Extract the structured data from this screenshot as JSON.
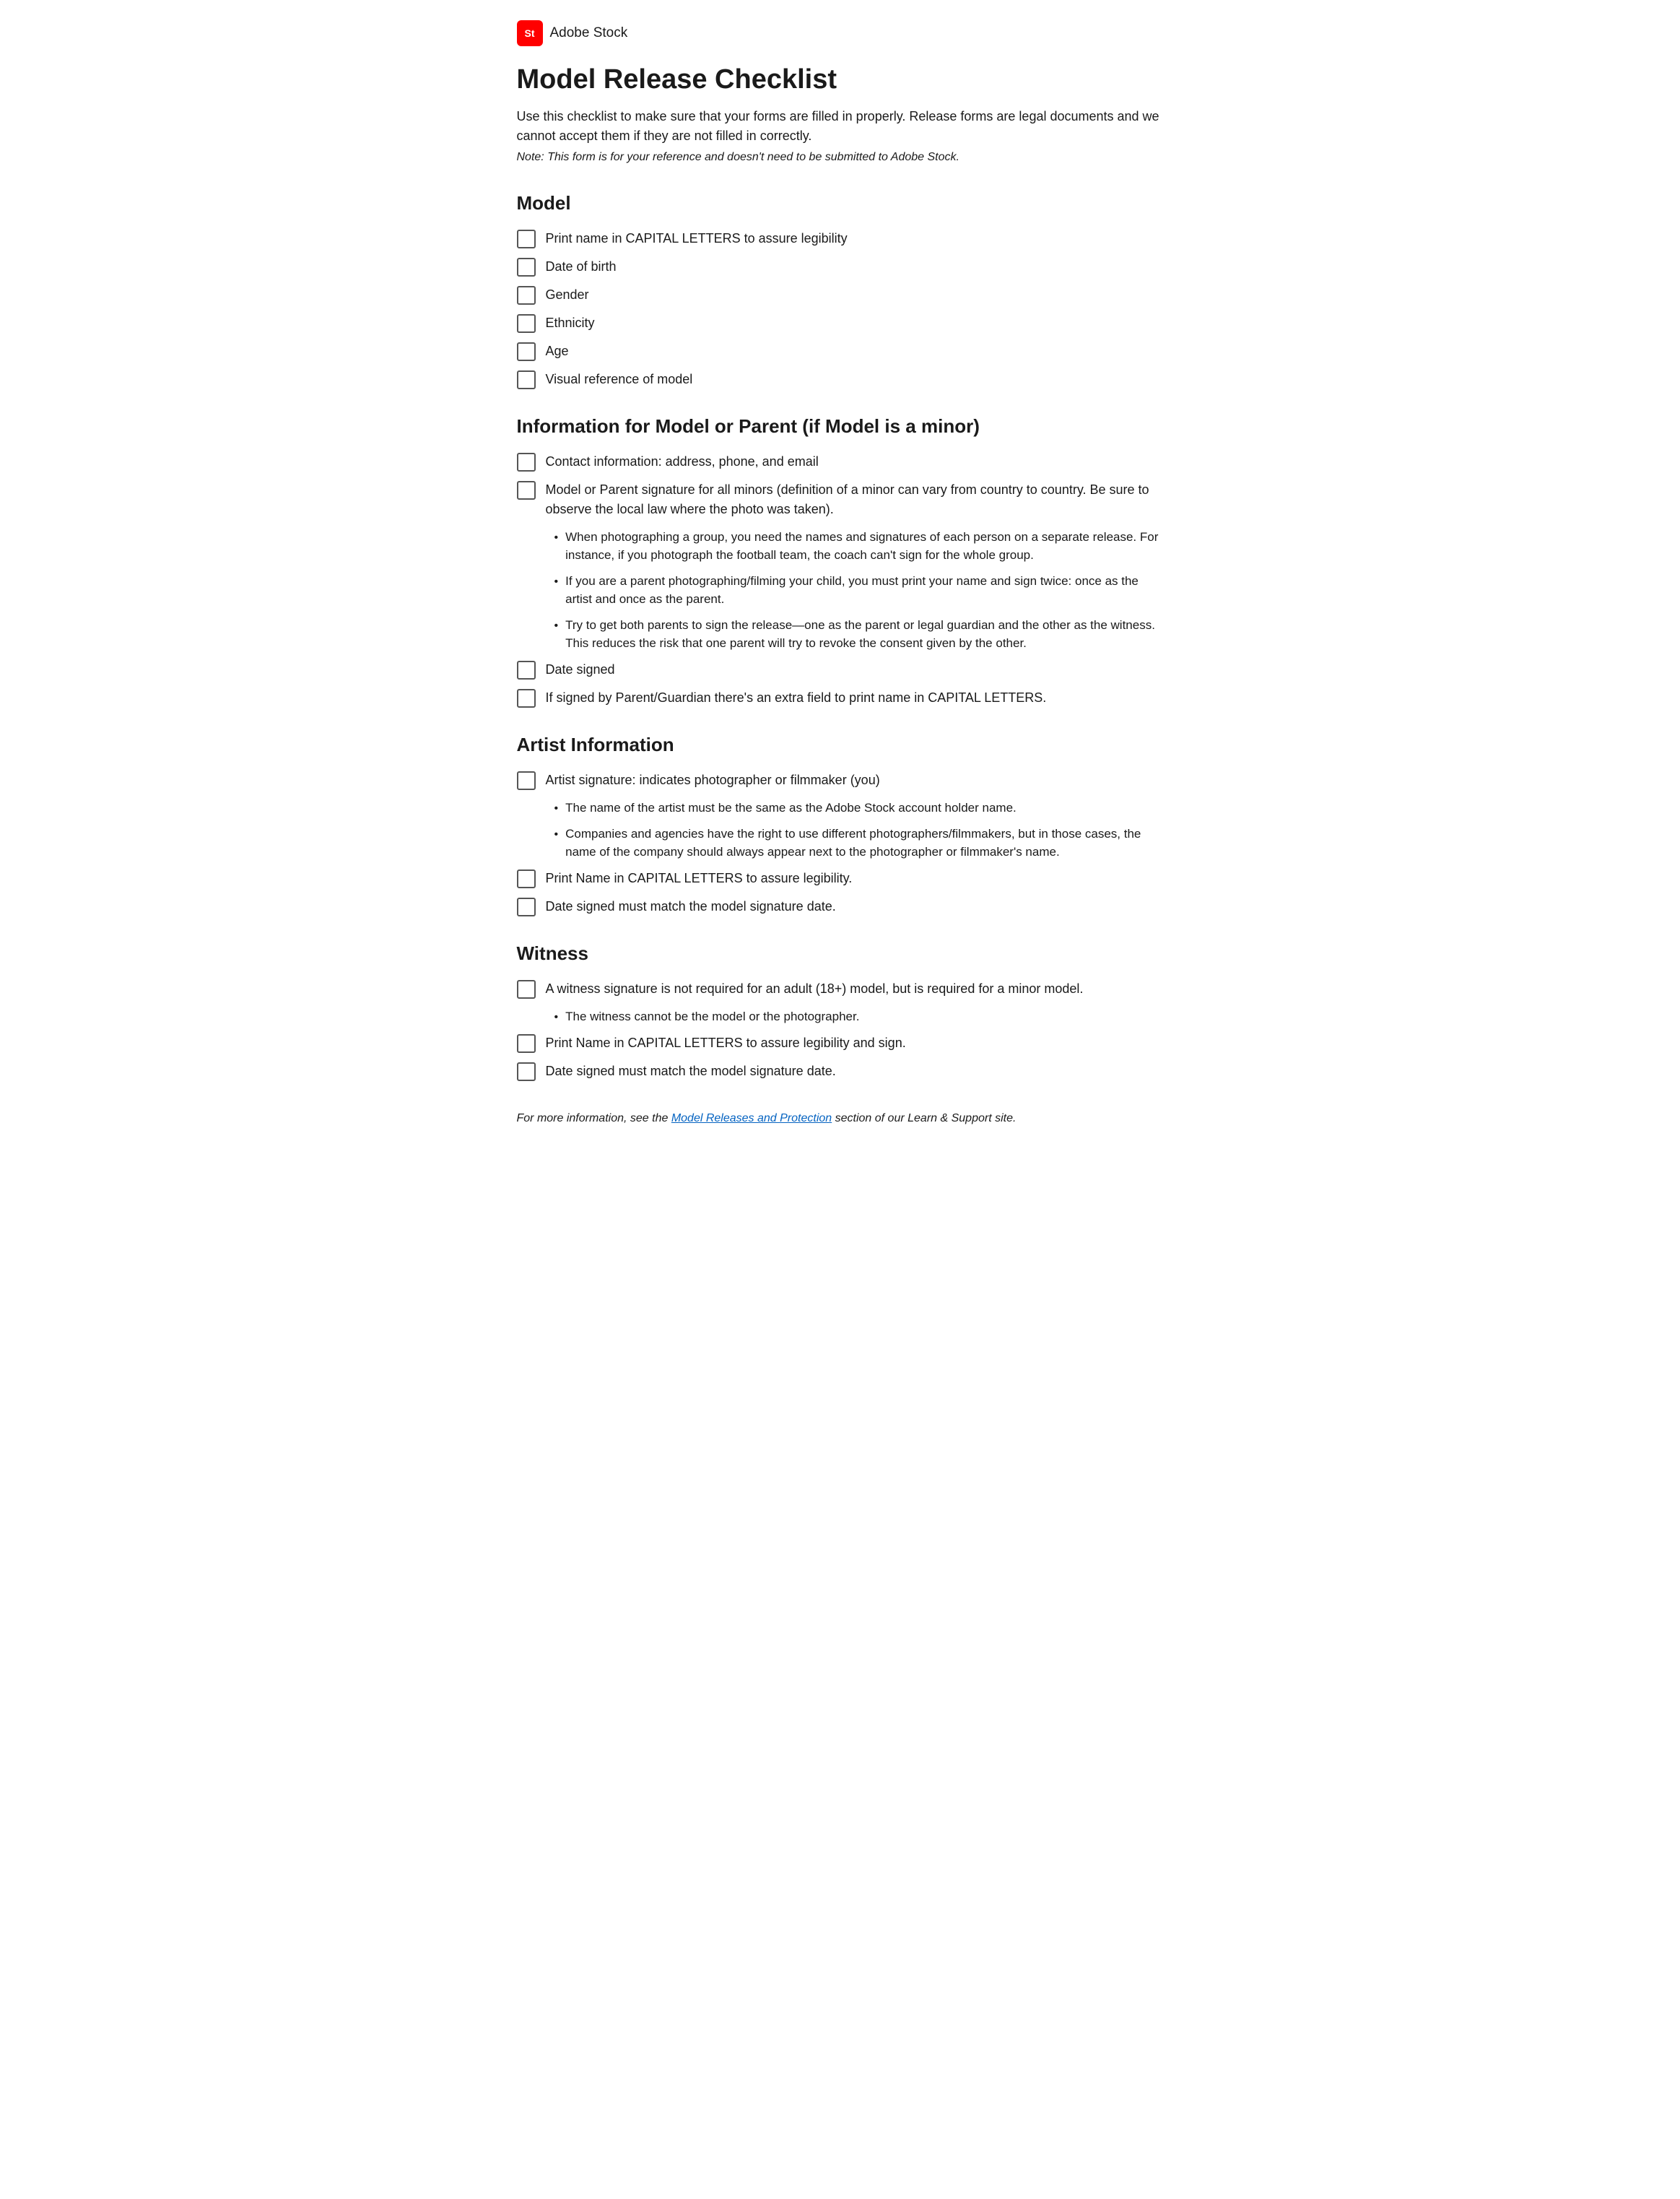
{
  "header": {
    "logo_text": "St",
    "brand_name": "Adobe Stock"
  },
  "page": {
    "title": "Model Release Checklist",
    "intro": "Use this checklist to make sure that your forms are filled in properly. Release forms are legal documents and we cannot accept them if they are not filled in correctly.",
    "note": "Note: This form is for your reference and doesn't need to be submitted to Adobe Stock."
  },
  "sections": [
    {
      "id": "model",
      "heading": "Model",
      "items": [
        {
          "id": "print-name",
          "text": "Print name in CAPITAL LETTERS to assure legibility"
        },
        {
          "id": "date-of-birth",
          "text": "Date of birth"
        },
        {
          "id": "gender",
          "text": "Gender"
        },
        {
          "id": "ethnicity",
          "text": "Ethnicity"
        },
        {
          "id": "age",
          "text": "Age"
        },
        {
          "id": "visual-reference",
          "text": "Visual reference of model"
        }
      ]
    },
    {
      "id": "info-model-parent",
      "heading": "Information for Model or Parent (if Model is a minor)",
      "items": [
        {
          "id": "contact-info",
          "text": "Contact information: address, phone, and email",
          "bullets": []
        },
        {
          "id": "model-parent-signature",
          "text": "Model or Parent signature for all minors (definition of a minor can vary from country to country. Be sure to observe the local law where the photo was taken).",
          "bullets": [
            "When photographing a group, you need the names and signatures of each person on a separate release. For instance, if you photograph the football team, the coach can't sign for the whole group.",
            "If you are a parent photographing/filming your child, you must print your name and sign twice: once as the artist and once as the parent.",
            "Try to get both parents to sign the release—one as the parent or legal guardian and the other as the witness. This reduces the risk that one parent will try to revoke the consent given by the other."
          ]
        },
        {
          "id": "date-signed-model",
          "text": "Date signed",
          "bullets": []
        },
        {
          "id": "parent-guardian-name",
          "text": "If signed by Parent/Guardian there's an extra field to print name in CAPITAL LETTERS.",
          "bullets": []
        }
      ]
    },
    {
      "id": "artist-info",
      "heading": "Artist Information",
      "items": [
        {
          "id": "artist-signature",
          "text": "Artist signature: indicates photographer or filmmaker (you)",
          "bullets": [
            "The name of the artist must be the same as the Adobe Stock account holder name.",
            "Companies and agencies have the right to use different photographers/filmmakers, but in those cases, the name of the company should always appear next to the photographer or filmmaker's name."
          ]
        },
        {
          "id": "artist-print-name",
          "text": "Print Name in CAPITAL LETTERS to assure legibility.",
          "bullets": []
        },
        {
          "id": "artist-date-signed",
          "text": "Date signed must match the model signature date.",
          "bullets": []
        }
      ]
    },
    {
      "id": "witness",
      "heading": "Witness",
      "items": [
        {
          "id": "witness-signature",
          "text": "A witness signature is not required for an adult (18+) model, but is required for a minor model.",
          "bullets": [
            "The witness cannot be the model or the photographer."
          ]
        },
        {
          "id": "witness-print-name",
          "text": "Print Name in CAPITAL LETTERS to assure legibility and sign.",
          "bullets": []
        },
        {
          "id": "witness-date-signed",
          "text": "Date signed must match the model signature date.",
          "bullets": []
        }
      ]
    }
  ],
  "footer": {
    "text_before_link": "For more information, see the ",
    "link_text": "Model Releases and Protection",
    "link_url": "#",
    "text_after_link": " section of our Learn & Support site."
  }
}
